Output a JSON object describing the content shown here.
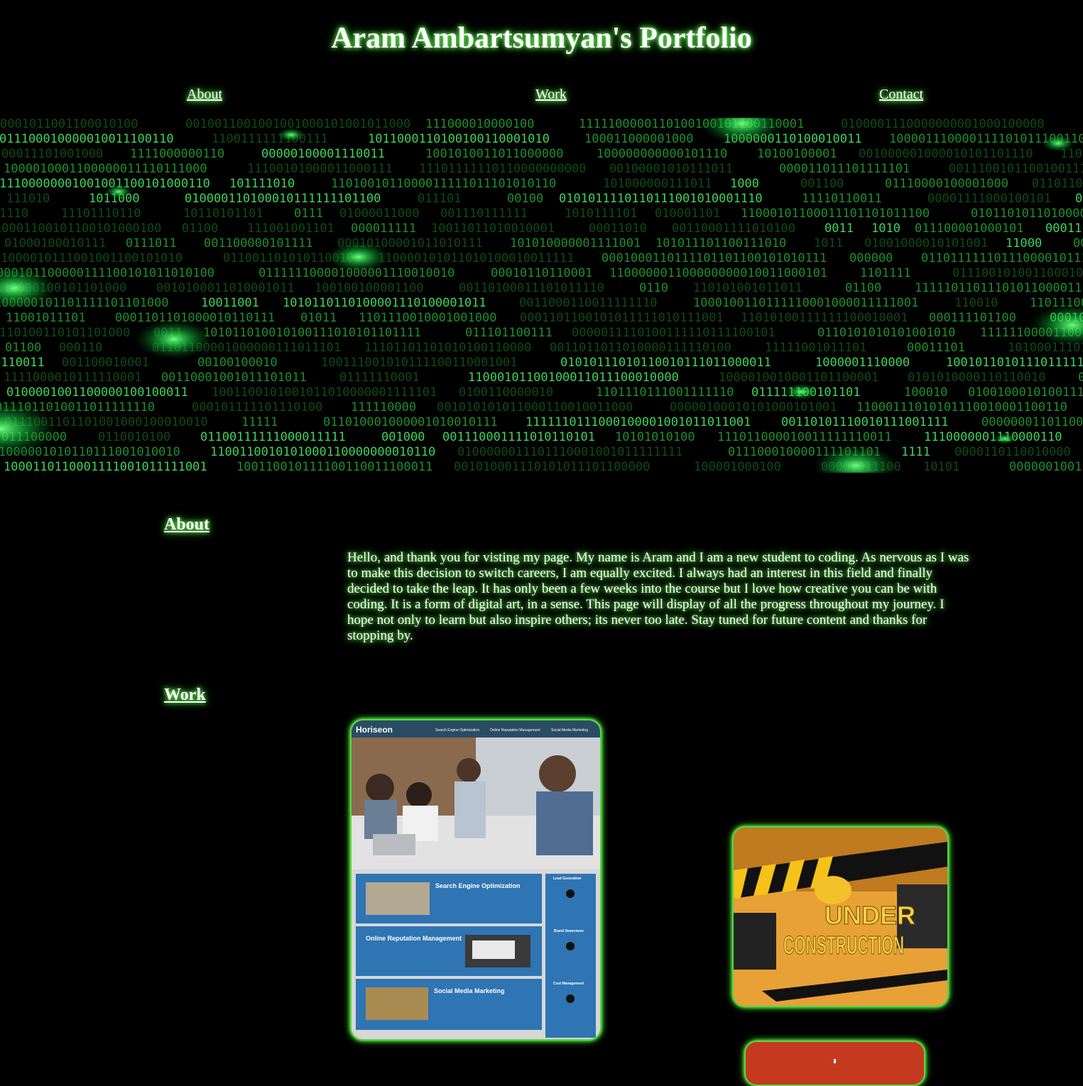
{
  "header": {
    "title": "Aram Ambartsumyan's Portfolio"
  },
  "nav": {
    "about": "About",
    "work": "Work",
    "contact": "Contact"
  },
  "about": {
    "heading": "About",
    "text": "Hello, and thank you for visting my page. My name is Aram and I am a new student to coding. As nervous as I was to make this decision to switch careers, I am equally excited. I always had an interest in this field and finally decided to take the leap. It has only been a few weeks into the course but I love how creative you can be with coding. It is a form of digital art, in a sense. This page will display of all the progress throughout my journey. I hope not only to learn but also inspire others; its never too late. Stay tuned for future content and thanks for stopping by."
  },
  "work": {
    "heading": "Work",
    "horiseon": {
      "brand": "Horiseon",
      "nav": [
        "Search Engine Optimization",
        "Online Reputation Management",
        "Social Media Marketing"
      ],
      "sections": [
        "Search Engine Optimization",
        "Online Reputation Management",
        "Social Media Marketing"
      ],
      "sidebar": [
        "Lead Generation",
        "Brand Awareness",
        "Cost Management"
      ]
    },
    "construction": {
      "line1": "UNDER",
      "line2": "CONSTRUCTION"
    }
  },
  "colors": {
    "background": "#000000",
    "glow": "#4bff3a",
    "matrix_green": "#1f8f2a"
  }
}
